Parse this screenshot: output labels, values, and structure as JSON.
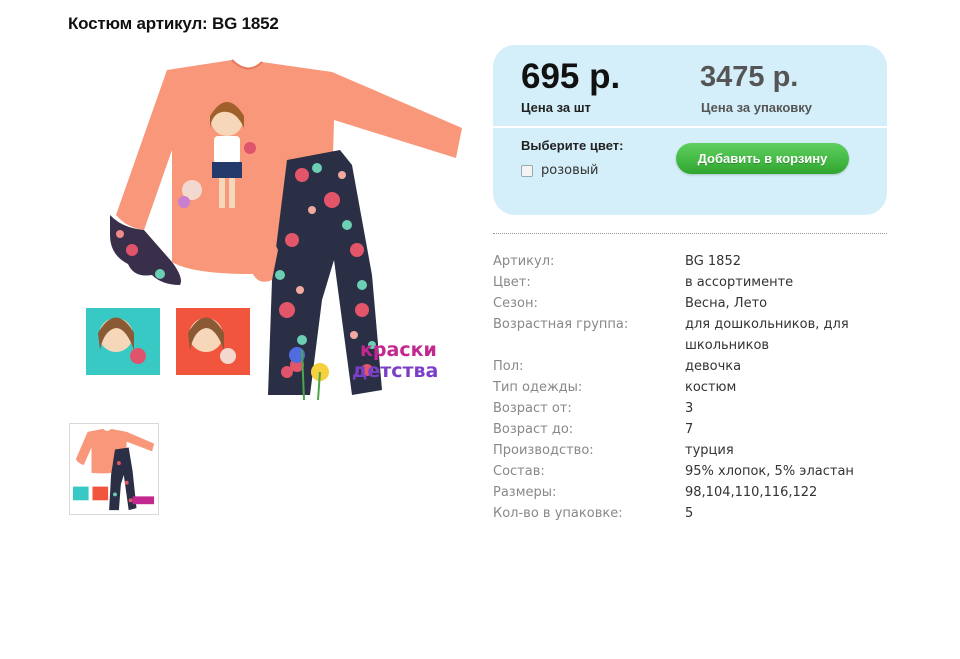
{
  "product": {
    "title": "Костюм артикул: BG 1852"
  },
  "price_box": {
    "unit_price": "695 р.",
    "unit_label": "Цена за шт",
    "pack_price": "3475 р.",
    "pack_label": "Цена за упаковку",
    "choose_color_label": "Выберите цвет:",
    "color_option": "розовый",
    "color_option_checked": false,
    "add_to_cart_label": "Добавить в корзину",
    "background_color": "#d4eff9",
    "button_color": "#3cb43c"
  },
  "specs": [
    {
      "label": "Артикул:",
      "value": "BG 1852"
    },
    {
      "label": "Цвет:",
      "value": "в ассортименте"
    },
    {
      "label": "Сезон:",
      "value": "Весна, Лето"
    },
    {
      "label": "Возрастная группа:",
      "value": "для дошкольников, для школьников"
    },
    {
      "label": "Пол:",
      "value": "девочка"
    },
    {
      "label": "Тип одежды:",
      "value": "костюм"
    },
    {
      "label": "Возраст от:",
      "value": "3"
    },
    {
      "label": "Возраст до:",
      "value": "7"
    },
    {
      "label": "Производство:",
      "value": "турция"
    },
    {
      "label": "Состав:",
      "value": "95% хлопок, 5% эластан"
    },
    {
      "label": "Размеры:",
      "value": "98,104,110,116,122"
    },
    {
      "label": "Кол-во в упаковке:",
      "value": "5"
    }
  ],
  "images": {
    "main_logo_text_line1": "краски",
    "main_logo_text_line2": "детства"
  }
}
